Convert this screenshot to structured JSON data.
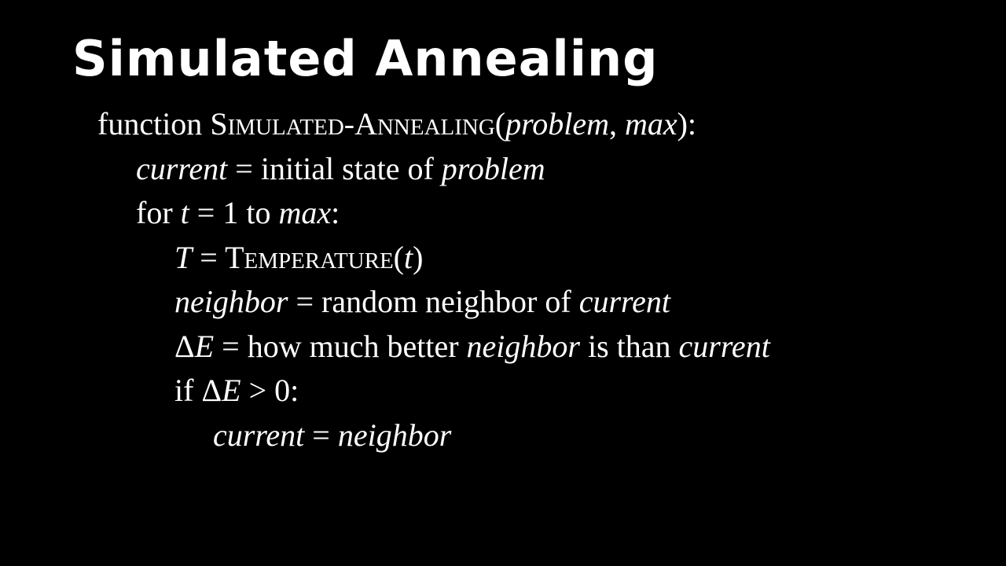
{
  "slide": {
    "title": "Simulated Annealing"
  },
  "pseudocode": {
    "line1": {
      "kw_function": "function ",
      "fn_S": "S",
      "fn_imulated": "IMULATED",
      "fn_dash": "-",
      "fn_A": "A",
      "fn_nnealing": "NNEALING",
      "open_paren": "(",
      "arg_problem": "problem",
      "comma": ", ",
      "arg_max": "max",
      "close": "):"
    },
    "line2": {
      "var_current": "current",
      "eq": " = initial state of ",
      "var_problem": "problem"
    },
    "line3": {
      "kw_for": "for ",
      "var_t": "t",
      "mid": " = 1 to ",
      "var_max": "max",
      "colon": ":"
    },
    "line4": {
      "var_T": "T",
      "eq": " = ",
      "fn_T": "T",
      "fn_emperature": "EMPERATURE",
      "open_paren": "(",
      "var_t": "t",
      "close_paren": ")"
    },
    "line5": {
      "var_neighbor": "neighbor",
      "eq": " = random neighbor of ",
      "var_current": "current"
    },
    "line6": {
      "delta": "Δ",
      "var_E": "E",
      "mid1": " = how much better ",
      "var_neighbor": "neighbor",
      "mid2": " is than ",
      "var_current": "current"
    },
    "line7": {
      "kw_if": "if ",
      "delta": "Δ",
      "var_E": "E",
      "cond": " > 0:"
    },
    "line8": {
      "var_current": "current",
      "eq": " = ",
      "var_neighbor": "neighbor"
    }
  }
}
